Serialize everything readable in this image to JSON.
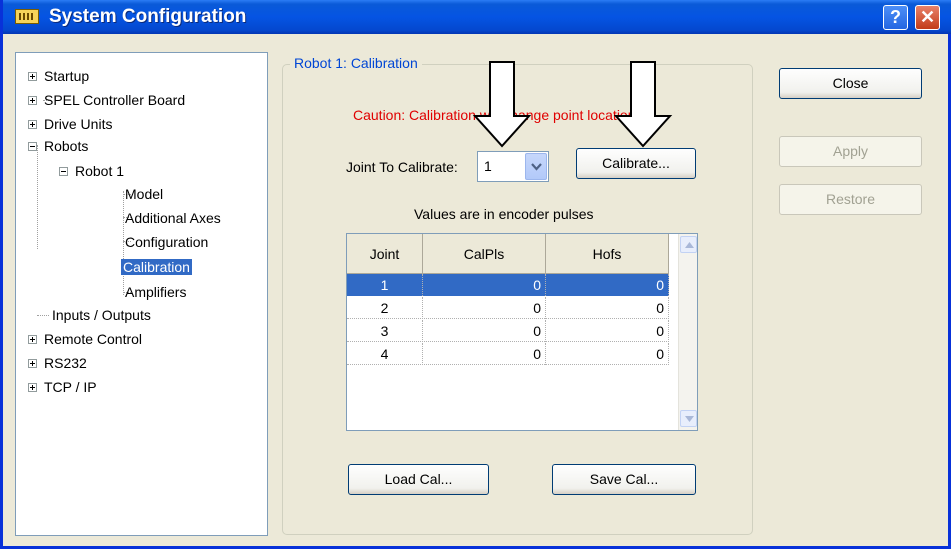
{
  "window": {
    "title": "System Configuration",
    "help_glyph": "?",
    "close_glyph": "✕"
  },
  "tree": {
    "items": [
      {
        "label": "Startup",
        "expander": "plus"
      },
      {
        "label": "SPEL Controller Board",
        "expander": "plus"
      },
      {
        "label": "Drive Units",
        "expander": "plus"
      },
      {
        "label": "Robots",
        "expander": "minus"
      },
      {
        "label": "Robot 1",
        "expander": "minus"
      },
      {
        "label": "Model"
      },
      {
        "label": "Additional Axes"
      },
      {
        "label": "Configuration"
      },
      {
        "label": "Calibration",
        "selected": true
      },
      {
        "label": "Amplifiers"
      },
      {
        "label": "Inputs / Outputs"
      },
      {
        "label": "Remote Control",
        "expander": "plus"
      },
      {
        "label": "RS232",
        "expander": "plus"
      },
      {
        "label": "TCP / IP",
        "expander": "plus"
      }
    ]
  },
  "panel": {
    "group_title": "Robot 1: Calibration",
    "caution": "Caution: Calibration will change point locations",
    "joint_label": "Joint To Calibrate:",
    "joint_value": "1",
    "calibrate_button": "Calibrate...",
    "encoder_note": "Values are in encoder pulses",
    "load_button": "Load Cal...",
    "save_button": "Save Cal..."
  },
  "table": {
    "columns": [
      "Joint",
      "CalPls",
      "Hofs"
    ],
    "rows": [
      [
        "1",
        "0",
        "0"
      ],
      [
        "2",
        "0",
        "0"
      ],
      [
        "3",
        "0",
        "0"
      ],
      [
        "4",
        "0",
        "0"
      ]
    ],
    "selected_row": 0
  },
  "actions": {
    "close": "Close",
    "apply": "Apply",
    "restore": "Restore"
  },
  "colors": {
    "title_bar": "#0554e3",
    "selection": "#316ac5",
    "caution_text": "#e00000",
    "group_title": "#0046d5"
  }
}
